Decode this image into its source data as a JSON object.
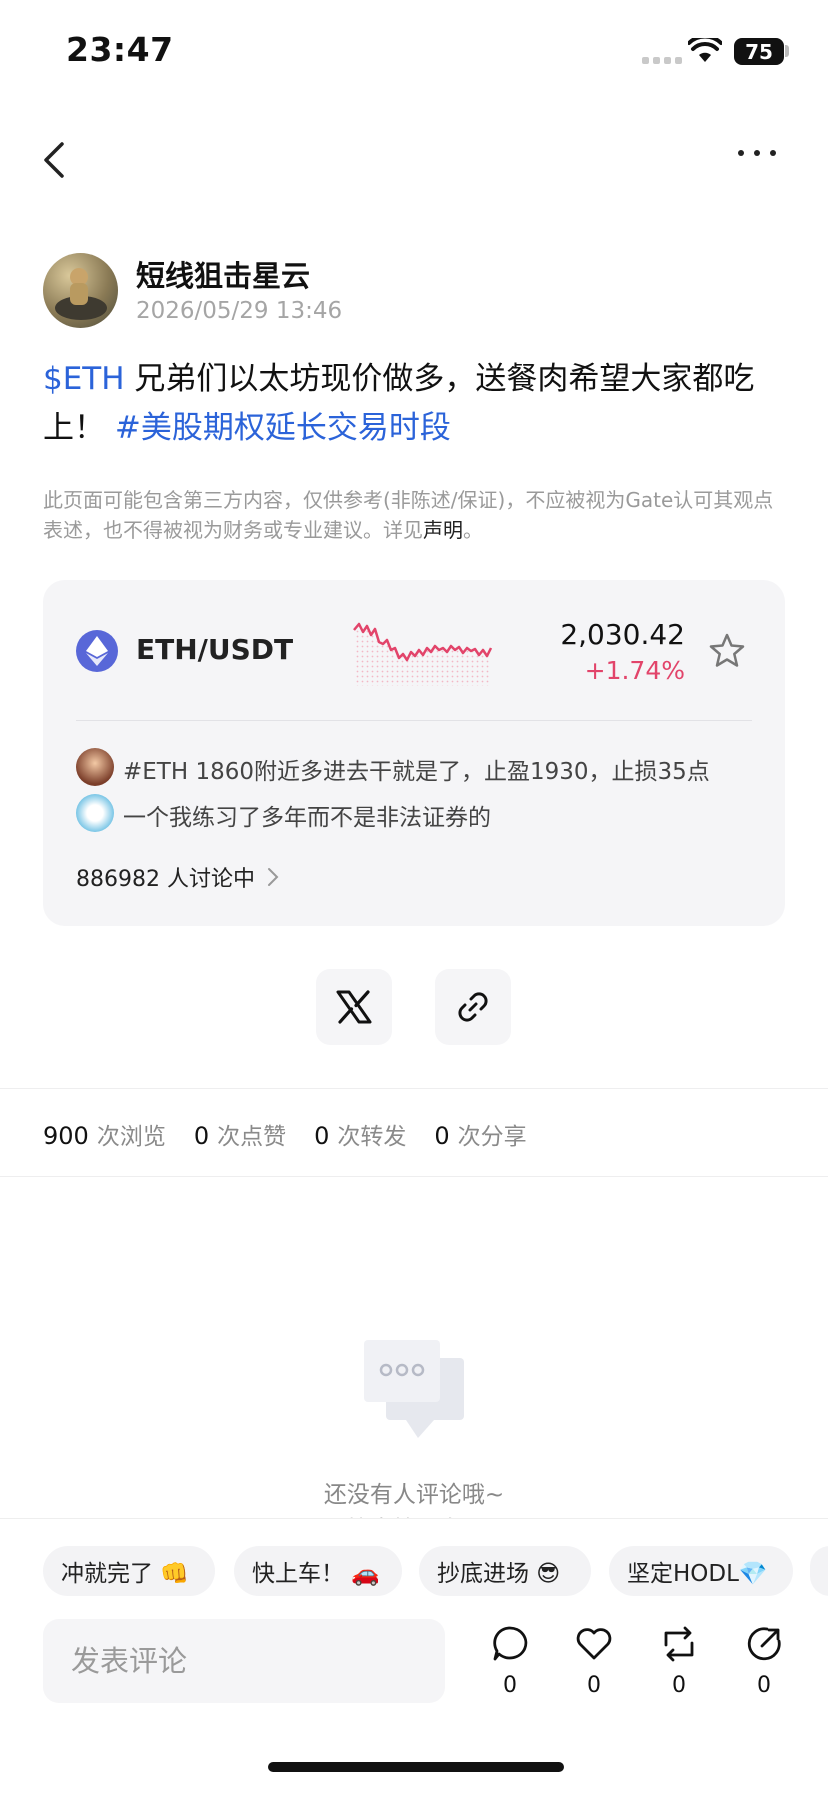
{
  "status_bar": {
    "time": "23:47",
    "battery": "75"
  },
  "author": {
    "name": "短线狙击星云",
    "time": "2026/05/29 13:46"
  },
  "post": {
    "ticker": "$ETH",
    "text": " 兄弟们以太坊现价做多，送餐肉希望大家都吃上！",
    "hashtag": "#美股期权延长交易时段"
  },
  "disclaimer": {
    "text": "此页面可能包含第三方内容，仅供参考(非陈述/保证)，不应被视为Gate认可其观点表述，也不得被视为财务或专业建议。详见",
    "link": "声明",
    "end": "。"
  },
  "market": {
    "pair": "ETH/USDT",
    "price": "2,030.42",
    "change": "+1.74%",
    "comments": [
      {
        "text": "#ETH 1860附近多进去干就是了，止盈1930，止损35点"
      },
      {
        "text": "一个我练习了多年而不是非法证券的"
      }
    ],
    "discussing": "886982 人讨论中"
  },
  "stats": [
    {
      "value": "900",
      "label": "次浏览"
    },
    {
      "value": "0",
      "label": "次点赞"
    },
    {
      "value": "0",
      "label": "次转发"
    },
    {
      "value": "0",
      "label": "次分享"
    }
  ],
  "empty": {
    "text": "还没有人评论哦~",
    "sub": "快来抢沙发~"
  },
  "quick_replies": [
    "冲就完了 👊",
    "快上车！ 🚗",
    "抄底进场 😎",
    "坚定HODL💎"
  ],
  "comment_input": {
    "placeholder": "发表评论"
  },
  "actions": {
    "comment": "0",
    "like": "0",
    "repost": "0",
    "share": "0"
  },
  "colors": {
    "link": "#2b63d9",
    "positive": "#e2446a",
    "eth": "#5867d8"
  }
}
